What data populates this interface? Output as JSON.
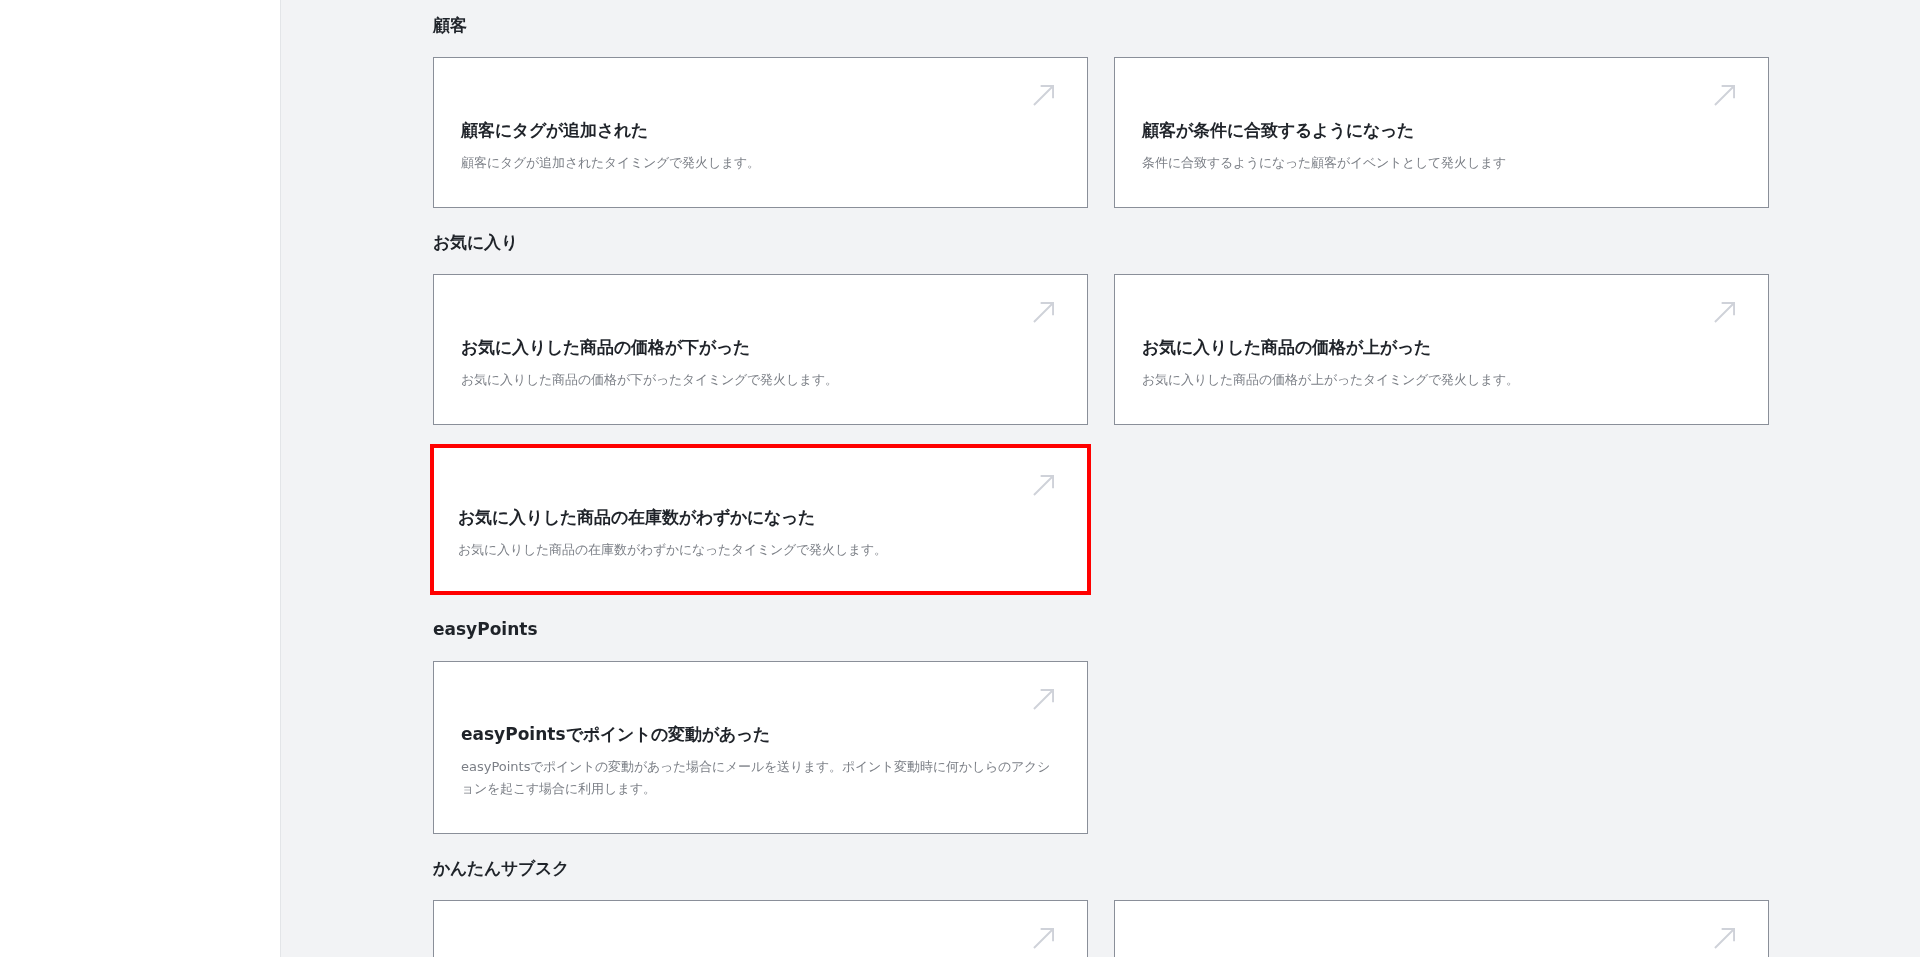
{
  "sections": [
    {
      "heading": "顧客",
      "cards": [
        {
          "title": "顧客にタグが追加された",
          "description": "顧客にタグが追加されたタイミングで発火します。",
          "highlighted": false
        },
        {
          "title": "顧客が条件に合致するようになった",
          "description": "条件に合致するようになった顧客がイベントとして発火します",
          "highlighted": false
        }
      ]
    },
    {
      "heading": "お気に入り",
      "cards": [
        {
          "title": "お気に入りした商品の価格が下がった",
          "description": "お気に入りした商品の価格が下がったタイミングで発火します。",
          "highlighted": false
        },
        {
          "title": "お気に入りした商品の価格が上がった",
          "description": "お気に入りした商品の価格が上がったタイミングで発火します。",
          "highlighted": false
        },
        {
          "title": "お気に入りした商品の在庫数がわずかになった",
          "description": "お気に入りした商品の在庫数がわずかになったタイミングで発火します。",
          "highlighted": true
        }
      ]
    },
    {
      "heading": "easyPoints",
      "cards": [
        {
          "title": "easyPointsでポイントの変動があった",
          "description": "easyPointsでポイントの変動があった場合にメールを送ります。ポイント変動時に何かしらのアクションを起こす場合に利用します。",
          "highlighted": false
        }
      ]
    },
    {
      "heading": "かんたんサブスク",
      "cards": [
        {
          "highlighted": false
        },
        {
          "highlighted": false
        }
      ]
    }
  ]
}
